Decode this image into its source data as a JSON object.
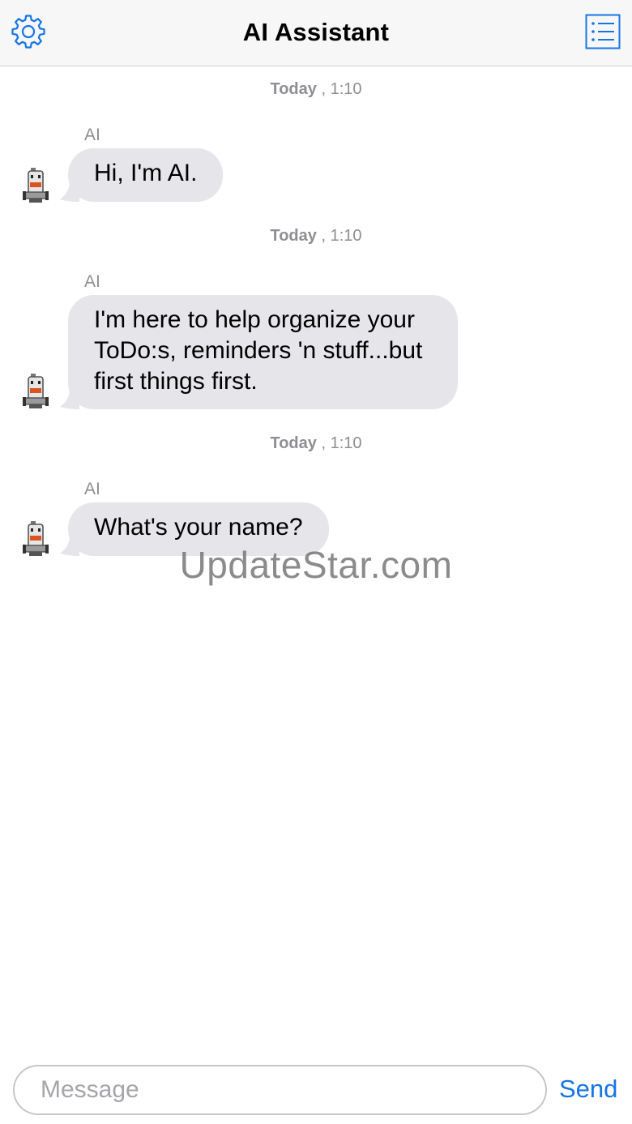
{
  "header": {
    "title": "AI Assistant",
    "settings_icon": "gear-icon",
    "list_icon": "list-icon",
    "accent_color": "#1575e6"
  },
  "messages": [
    {
      "timestamp_day": "Today",
      "timestamp_time": " , 1:10",
      "sender": "AI",
      "text": "Hi, I'm AI."
    },
    {
      "timestamp_day": "Today",
      "timestamp_time": " , 1:10",
      "sender": "AI",
      "text": "I'm here to help organize your ToDo:s, reminders 'n stuff...but first things first."
    },
    {
      "timestamp_day": "Today",
      "timestamp_time": " , 1:10",
      "sender": "AI",
      "text": "What's your name?"
    }
  ],
  "watermark": "UpdateStar.com",
  "composer": {
    "placeholder": "Message",
    "send_label": "Send"
  }
}
